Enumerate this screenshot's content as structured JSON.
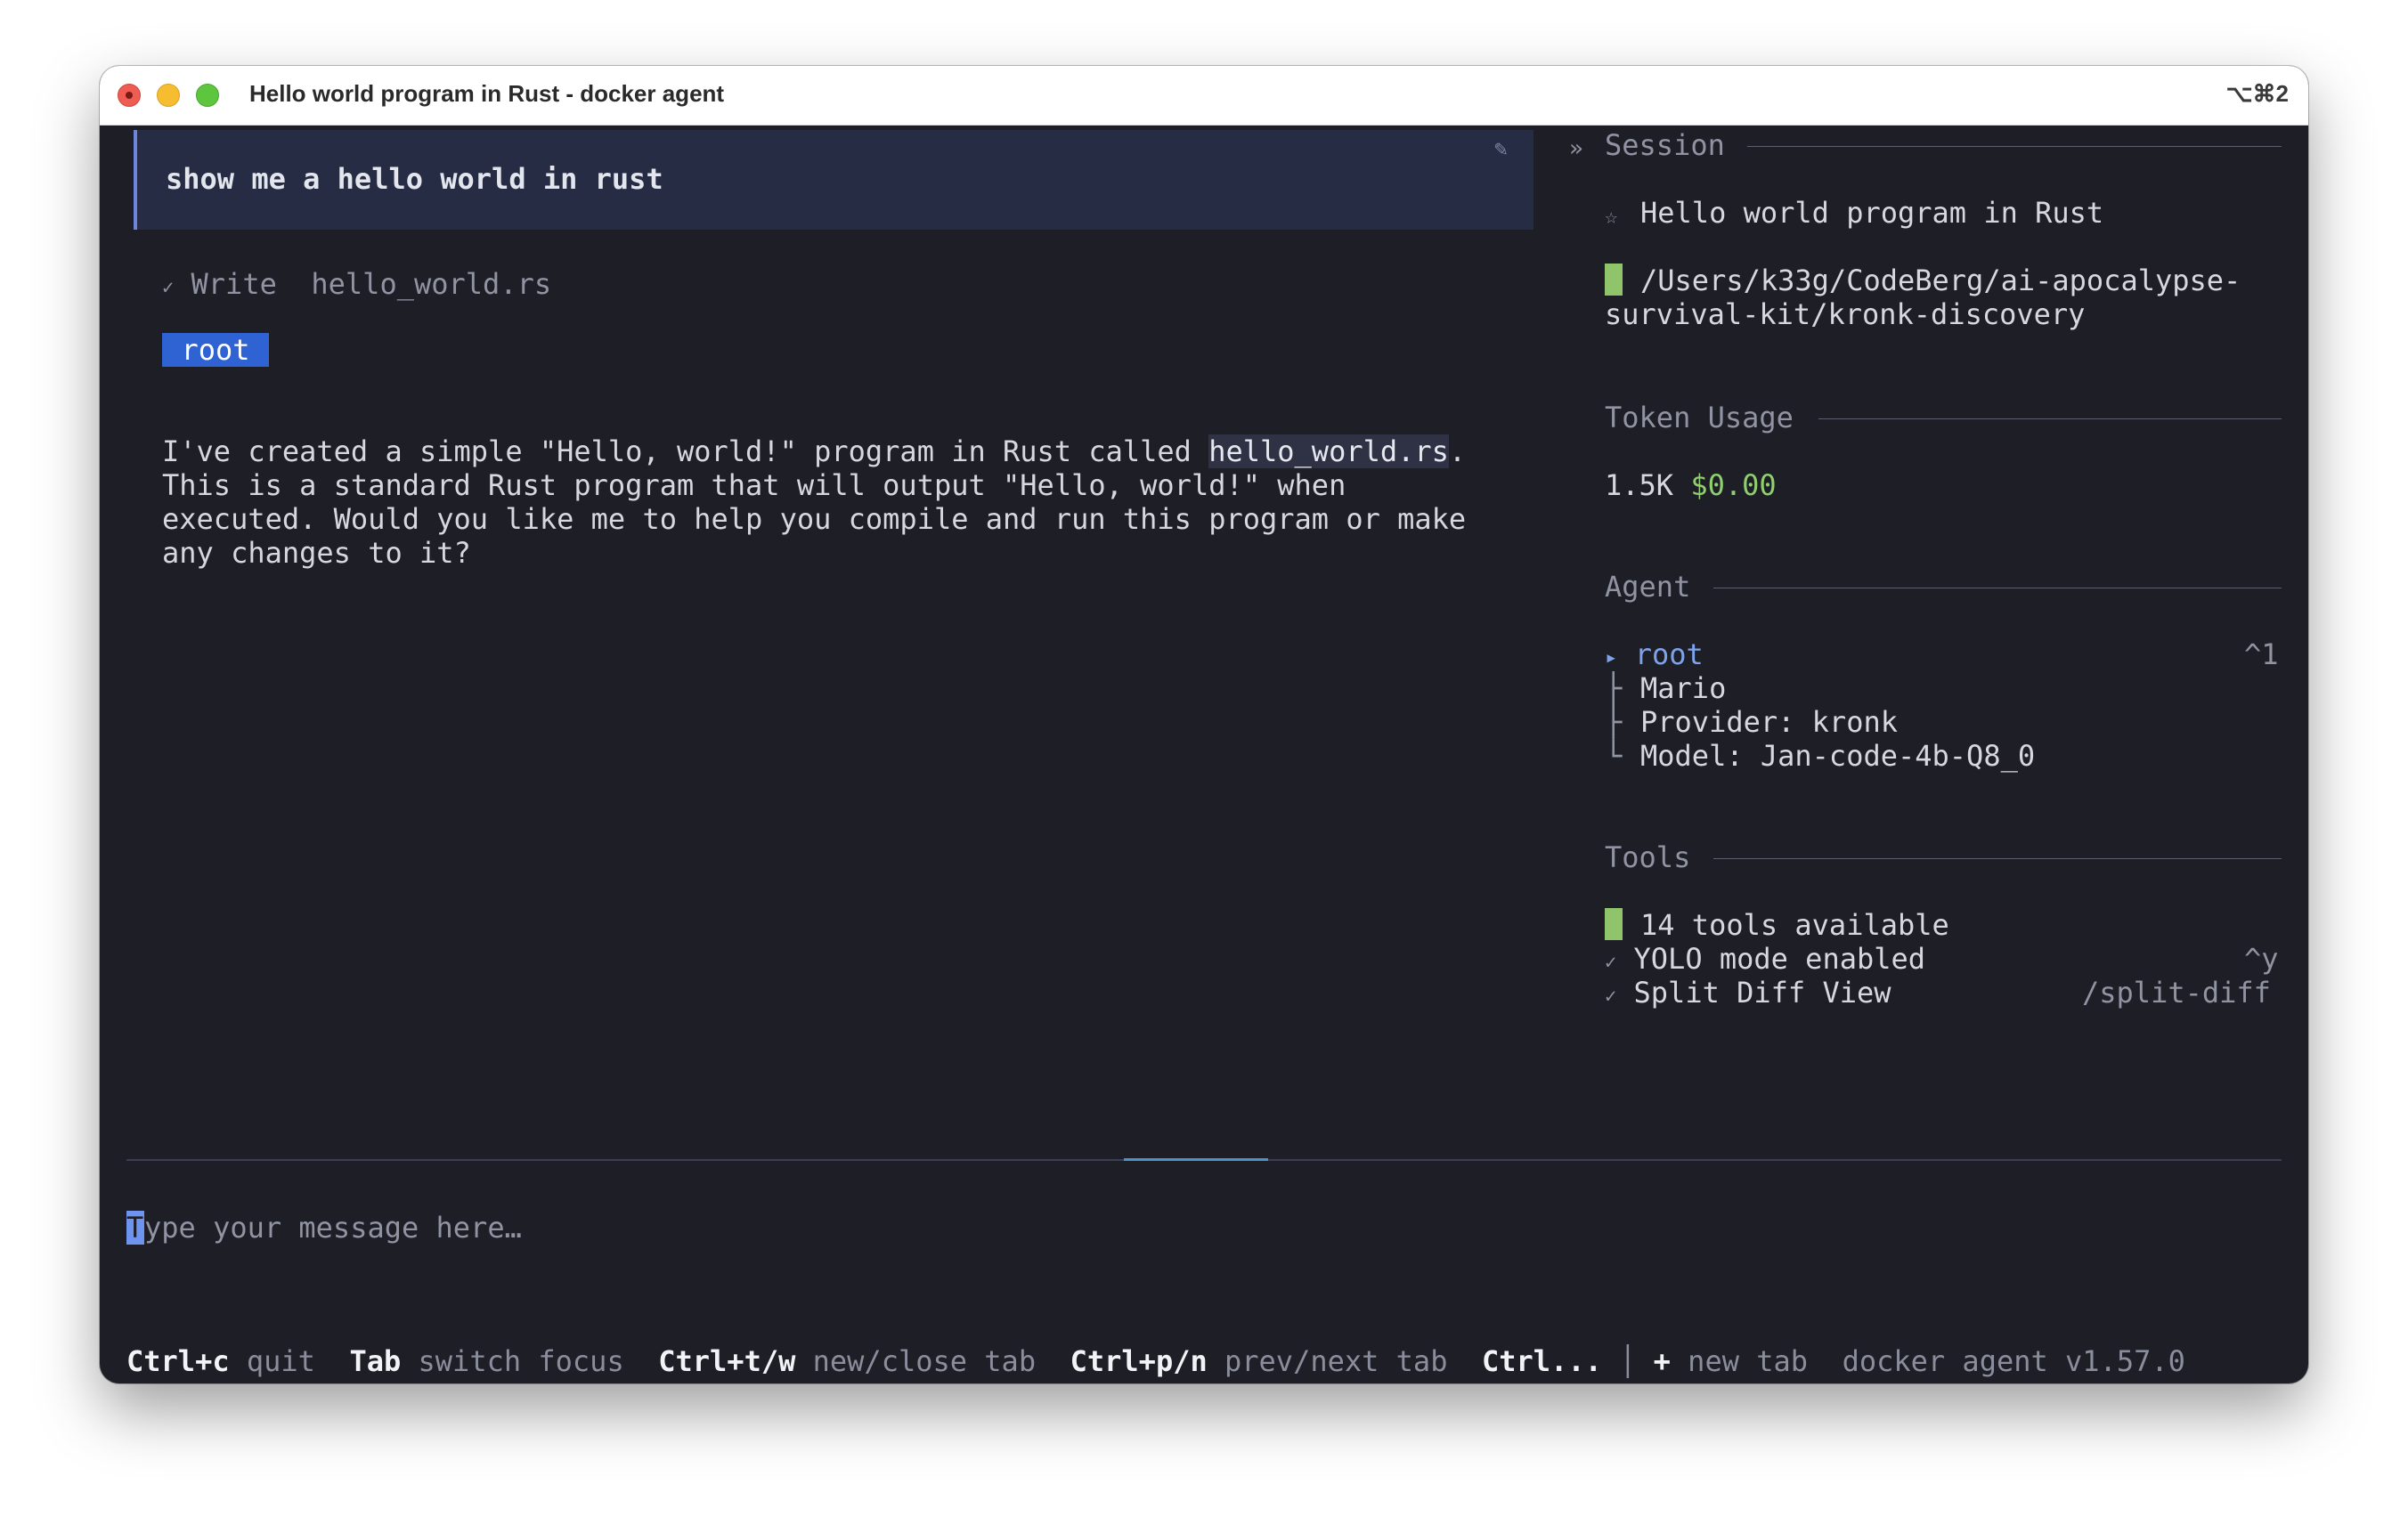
{
  "window": {
    "title": "Hello world program in Rust - docker agent",
    "shortcut": "⌥⌘2"
  },
  "chat": {
    "user_message": "show me a hello world in rust",
    "edit_icon": "✎",
    "tool_call": {
      "status_icon": "✓",
      "action": "Write",
      "file": "hello_world.rs"
    },
    "agent_label": "root",
    "response": {
      "line1_prefix": "I've created a simple \"Hello, world!\" program in Rust called ",
      "line1_code": "hello_world.rs",
      "line1_suffix": ".",
      "line2": "This is a standard Rust program that will output \"Hello, world!\" when",
      "line3": "executed. Would you like me to help you compile and run this program or make",
      "line4": "any changes to it?"
    }
  },
  "sidebar": {
    "collapse_icon": "»",
    "session": {
      "heading": "Session",
      "star_icon": "☆",
      "title": "Hello world program in Rust",
      "path_line1": "/Users/k33g/CodeBerg/ai-apocalypse-",
      "path_line2": "survival-kit/kronk-discovery"
    },
    "token_usage": {
      "heading": "Token Usage",
      "tokens": "1.5K",
      "cost": "$0.00"
    },
    "agent": {
      "heading": "Agent",
      "arrow": "▸",
      "name": "root",
      "shortcut": "^1",
      "tree_mid": "├",
      "tree_end": "└",
      "description": "Mario",
      "provider": "Provider: kronk",
      "model": "Model: Jan-code-4b-Q8_0"
    },
    "tools": {
      "heading": "Tools",
      "available": "14 tools available",
      "check_icon": "✓",
      "yolo": "YOLO mode enabled",
      "yolo_shortcut": "^y",
      "split": "Split Diff View",
      "split_command": "/split-diff"
    }
  },
  "input": {
    "cursor_char": "T",
    "placeholder_rest": "ype your message here…"
  },
  "statusbar": {
    "k1": "Ctrl+c",
    "d1": "quit",
    "k2": "Tab",
    "d2": "switch focus",
    "k3": "Ctrl+t/w",
    "d3": "new/close tab",
    "k4": "Ctrl+p/n",
    "d4": "prev/next tab",
    "k5": "Ctrl...",
    "sep": "│",
    "k6": "+",
    "d6": "new tab",
    "version": "docker agent v1.57.0"
  }
}
